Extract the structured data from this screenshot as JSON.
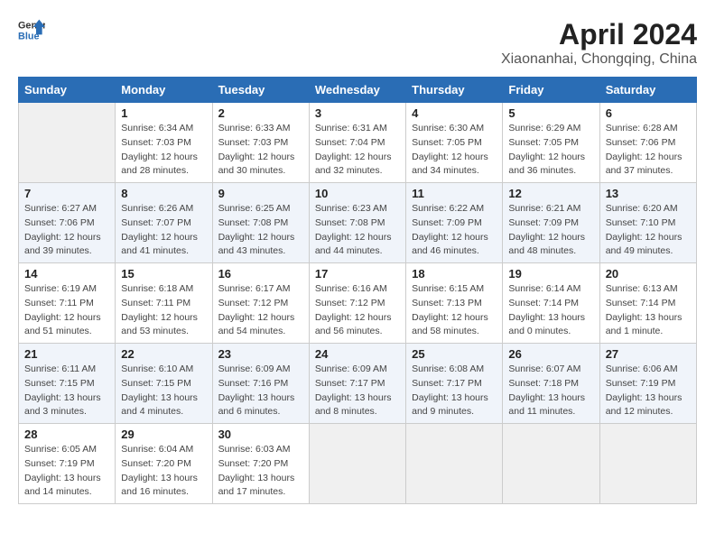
{
  "header": {
    "logo_general": "General",
    "logo_blue": "Blue",
    "month_title": "April 2024",
    "location": "Xiaonanhai, Chongqing, China"
  },
  "weekdays": [
    "Sunday",
    "Monday",
    "Tuesday",
    "Wednesday",
    "Thursday",
    "Friday",
    "Saturday"
  ],
  "weeks": [
    [
      {
        "day": "",
        "empty": true
      },
      {
        "day": "1",
        "sunrise": "6:34 AM",
        "sunset": "7:03 PM",
        "daylight": "12 hours and 28 minutes."
      },
      {
        "day": "2",
        "sunrise": "6:33 AM",
        "sunset": "7:03 PM",
        "daylight": "12 hours and 30 minutes."
      },
      {
        "day": "3",
        "sunrise": "6:31 AM",
        "sunset": "7:04 PM",
        "daylight": "12 hours and 32 minutes."
      },
      {
        "day": "4",
        "sunrise": "6:30 AM",
        "sunset": "7:05 PM",
        "daylight": "12 hours and 34 minutes."
      },
      {
        "day": "5",
        "sunrise": "6:29 AM",
        "sunset": "7:05 PM",
        "daylight": "12 hours and 36 minutes."
      },
      {
        "day": "6",
        "sunrise": "6:28 AM",
        "sunset": "7:06 PM",
        "daylight": "12 hours and 37 minutes."
      }
    ],
    [
      {
        "day": "7",
        "sunrise": "6:27 AM",
        "sunset": "7:06 PM",
        "daylight": "12 hours and 39 minutes."
      },
      {
        "day": "8",
        "sunrise": "6:26 AM",
        "sunset": "7:07 PM",
        "daylight": "12 hours and 41 minutes."
      },
      {
        "day": "9",
        "sunrise": "6:25 AM",
        "sunset": "7:08 PM",
        "daylight": "12 hours and 43 minutes."
      },
      {
        "day": "10",
        "sunrise": "6:23 AM",
        "sunset": "7:08 PM",
        "daylight": "12 hours and 44 minutes."
      },
      {
        "day": "11",
        "sunrise": "6:22 AM",
        "sunset": "7:09 PM",
        "daylight": "12 hours and 46 minutes."
      },
      {
        "day": "12",
        "sunrise": "6:21 AM",
        "sunset": "7:09 PM",
        "daylight": "12 hours and 48 minutes."
      },
      {
        "day": "13",
        "sunrise": "6:20 AM",
        "sunset": "7:10 PM",
        "daylight": "12 hours and 49 minutes."
      }
    ],
    [
      {
        "day": "14",
        "sunrise": "6:19 AM",
        "sunset": "7:11 PM",
        "daylight": "12 hours and 51 minutes."
      },
      {
        "day": "15",
        "sunrise": "6:18 AM",
        "sunset": "7:11 PM",
        "daylight": "12 hours and 53 minutes."
      },
      {
        "day": "16",
        "sunrise": "6:17 AM",
        "sunset": "7:12 PM",
        "daylight": "12 hours and 54 minutes."
      },
      {
        "day": "17",
        "sunrise": "6:16 AM",
        "sunset": "7:12 PM",
        "daylight": "12 hours and 56 minutes."
      },
      {
        "day": "18",
        "sunrise": "6:15 AM",
        "sunset": "7:13 PM",
        "daylight": "12 hours and 58 minutes."
      },
      {
        "day": "19",
        "sunrise": "6:14 AM",
        "sunset": "7:14 PM",
        "daylight": "13 hours and 0 minutes."
      },
      {
        "day": "20",
        "sunrise": "6:13 AM",
        "sunset": "7:14 PM",
        "daylight": "13 hours and 1 minute."
      }
    ],
    [
      {
        "day": "21",
        "sunrise": "6:11 AM",
        "sunset": "7:15 PM",
        "daylight": "13 hours and 3 minutes."
      },
      {
        "day": "22",
        "sunrise": "6:10 AM",
        "sunset": "7:15 PM",
        "daylight": "13 hours and 4 minutes."
      },
      {
        "day": "23",
        "sunrise": "6:09 AM",
        "sunset": "7:16 PM",
        "daylight": "13 hours and 6 minutes."
      },
      {
        "day": "24",
        "sunrise": "6:09 AM",
        "sunset": "7:17 PM",
        "daylight": "13 hours and 8 minutes."
      },
      {
        "day": "25",
        "sunrise": "6:08 AM",
        "sunset": "7:17 PM",
        "daylight": "13 hours and 9 minutes."
      },
      {
        "day": "26",
        "sunrise": "6:07 AM",
        "sunset": "7:18 PM",
        "daylight": "13 hours and 11 minutes."
      },
      {
        "day": "27",
        "sunrise": "6:06 AM",
        "sunset": "7:19 PM",
        "daylight": "13 hours and 12 minutes."
      }
    ],
    [
      {
        "day": "28",
        "sunrise": "6:05 AM",
        "sunset": "7:19 PM",
        "daylight": "13 hours and 14 minutes."
      },
      {
        "day": "29",
        "sunrise": "6:04 AM",
        "sunset": "7:20 PM",
        "daylight": "13 hours and 16 minutes."
      },
      {
        "day": "30",
        "sunrise": "6:03 AM",
        "sunset": "7:20 PM",
        "daylight": "13 hours and 17 minutes."
      },
      {
        "day": "",
        "empty": true
      },
      {
        "day": "",
        "empty": true
      },
      {
        "day": "",
        "empty": true
      },
      {
        "day": "",
        "empty": true
      }
    ]
  ],
  "labels": {
    "sunrise": "Sunrise:",
    "sunset": "Sunset:",
    "daylight": "Daylight:"
  }
}
